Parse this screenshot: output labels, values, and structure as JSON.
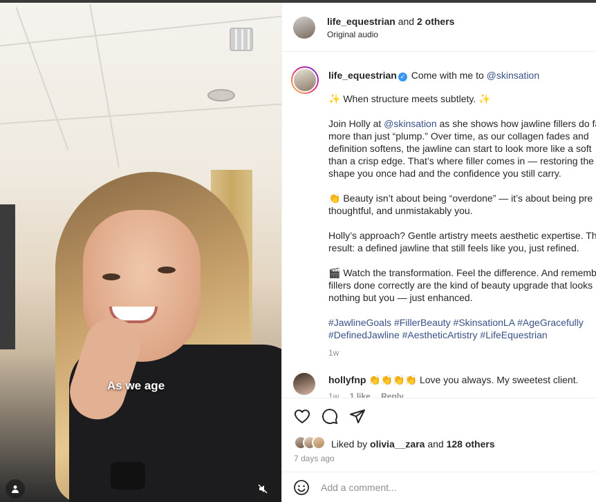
{
  "video": {
    "caption": "As we age",
    "controls": {
      "profile_icon": "user-icon",
      "mute_icon": "muted-speaker-icon"
    }
  },
  "header": {
    "username": "life_equestrian",
    "and_text": "and",
    "others": "2 others",
    "audio": "Original audio"
  },
  "post_caption": {
    "username": "life_equestrian",
    "verified_icon": "verified-badge-icon",
    "intro_text": "Come with me to",
    "intro_mention": "@skinsation",
    "lines": [
      {
        "segments": [
          {
            "t": "✨ When structure meets subtlety. ✨"
          }
        ]
      },
      {
        "break": true
      },
      {
        "segments": [
          {
            "t": "Join Holly at "
          },
          {
            "t": "@skinsation",
            "link": true
          },
          {
            "t": " as she shows how jawline fillers do far"
          }
        ]
      },
      {
        "segments": [
          {
            "t": "more than just “plump.” Over time, as our collagen fades and"
          }
        ]
      },
      {
        "segments": [
          {
            "t": "definition softens, the jawline can start to look more like a soft"
          }
        ]
      },
      {
        "segments": [
          {
            "t": "than a crisp edge. That’s where filler comes in — restoring the"
          }
        ]
      },
      {
        "segments": [
          {
            "t": "shape you once had and the confidence you still carry."
          }
        ]
      },
      {
        "break": true
      },
      {
        "segments": [
          {
            "t": "👏 Beauty isn’t about being “overdone” — it’s about being pre"
          }
        ]
      },
      {
        "segments": [
          {
            "t": "thoughtful, and unmistakably you."
          }
        ]
      },
      {
        "break": true
      },
      {
        "segments": [
          {
            "t": "Holly’s approach? Gentle artistry meets aesthetic expertise. The"
          }
        ]
      },
      {
        "segments": [
          {
            "t": "result: a defined jawline that still feels like you, just refined."
          }
        ]
      },
      {
        "break": true
      },
      {
        "segments": [
          {
            "t": "🎬 Watch the transformation. Feel the difference. And rememb"
          }
        ]
      },
      {
        "segments": [
          {
            "t": "fillers done correctly are the kind of beauty upgrade that looks"
          }
        ]
      },
      {
        "segments": [
          {
            "t": "nothing but you — just enhanced."
          }
        ]
      },
      {
        "break": true
      },
      {
        "segments": [
          {
            "t": "#JawlineGoals #FillerBeauty #SkinsationLA #AgeGracefully",
            "link": true
          }
        ]
      },
      {
        "segments": [
          {
            "t": "#DefinedJawline #AestheticArtistry #LifeEquestrian",
            "link": true
          }
        ]
      }
    ],
    "time": "1w"
  },
  "comment": {
    "username": "hollyfnp",
    "text": "👏👏👏👏 Love you always. My sweetest client.",
    "time": "1w",
    "likes": "1 like",
    "reply": "Reply"
  },
  "actions": {
    "like_icon": "heart-icon",
    "comment_icon": "comment-bubble-icon",
    "share_icon": "paper-plane-icon",
    "liked_by_prefix": "Liked by",
    "liked_by_user": "olivia__zara",
    "liked_by_and": "and",
    "liked_by_others": "128 others",
    "date": "7 days ago"
  },
  "add_comment": {
    "emoji_icon": "smiley-icon",
    "placeholder": "Add a comment..."
  }
}
